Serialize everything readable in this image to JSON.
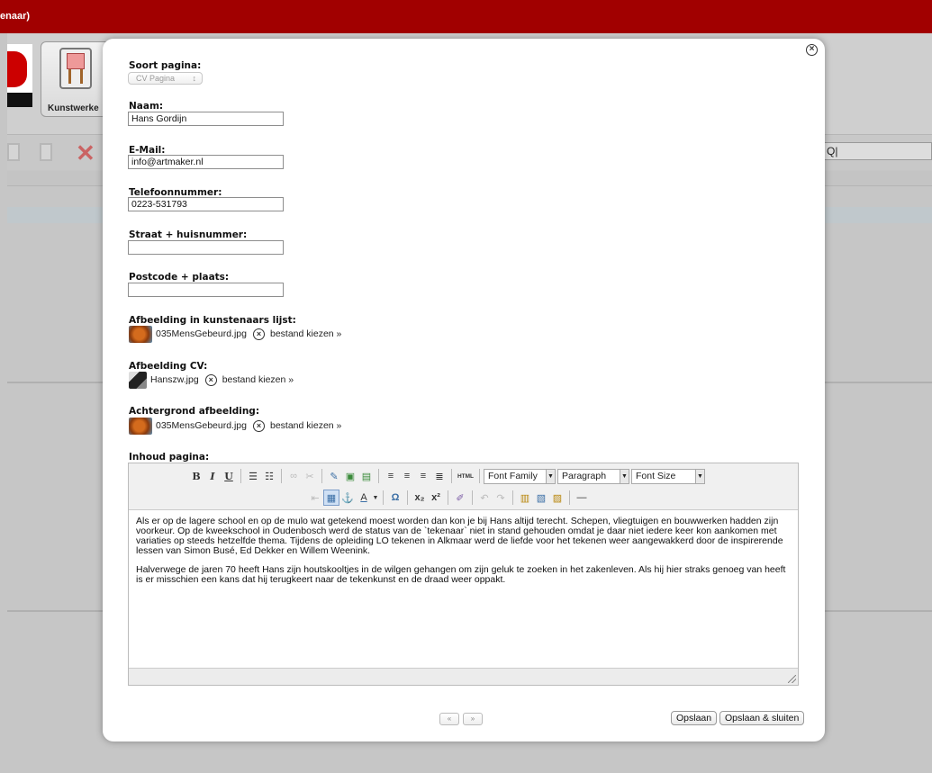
{
  "app": {
    "title_fragment": "enaar)",
    "tile_label": "Kunstwerke",
    "search_text": "Q|"
  },
  "modal": {
    "close_glyph": "×",
    "page_type": {
      "label": "Soort pagina:",
      "value": "CV Pagina",
      "arrows": "↕"
    },
    "fields": [
      {
        "label": "Naam:",
        "value": "Hans Gordijn"
      },
      {
        "label": "E-Mail:",
        "value": "info@artmaker.nl"
      },
      {
        "label": "Telefoonnummer:",
        "value": "0223-531793"
      },
      {
        "label": "Straat + huisnummer:",
        "value": ""
      },
      {
        "label": "Postcode + plaats:",
        "value": ""
      }
    ],
    "files": [
      {
        "label": "Afbeelding in kunstenaars lijst:",
        "filename": "035MensGebeurd.jpg",
        "link": "bestand kiezen »"
      },
      {
        "label": "Afbeelding CV:",
        "filename": "Hanszw.jpg",
        "link": "bestand kiezen »"
      },
      {
        "label": "Achtergrond afbeelding:",
        "filename": "035MensGebeurd.jpg",
        "link": "bestand kiezen »"
      }
    ],
    "content": {
      "label": "Inhoud pagina:",
      "toolbar": {
        "bold": "B",
        "italic": "I",
        "underline": "U",
        "html": "HTML",
        "font_family": "Font Family",
        "format": "Paragraph",
        "font_size": "Font Size",
        "omega": "Ω",
        "subscript": "x₂",
        "superscript": "x²",
        "hr": "—"
      },
      "paragraphs": [
        "Als er op de lagere school en op de mulo wat getekend moest worden dan kon je bij Hans altijd terecht. Schepen, vliegtuigen en bouwwerken hadden zijn voorkeur. Op de kweekschool in Oudenbosch werd de status van de `tekenaar` niet in stand gehouden omdat je daar niet iedere keer kon aankomen met variaties op steeds hetzelfde thema. Tijdens de opleiding LO tekenen in Alkmaar werd de liefde voor het tekenen weer aangewakkerd door de inspirerende lessen van Simon Busé, Ed Dekker en Willem Weenink.",
        "Halverwege de jaren 70 heeft Hans zijn houtskooltjes in de wilgen gehangen om zijn geluk te zoeken in het zakenleven. Als hij hier straks genoeg van heeft is er misschien een kans dat hij terugkeert naar de tekenkunst en de draad weer oppakt."
      ]
    },
    "footer": {
      "prev": "«",
      "next": "»",
      "save": "Opslaan",
      "save_close": "Opslaan & sluiten"
    }
  }
}
